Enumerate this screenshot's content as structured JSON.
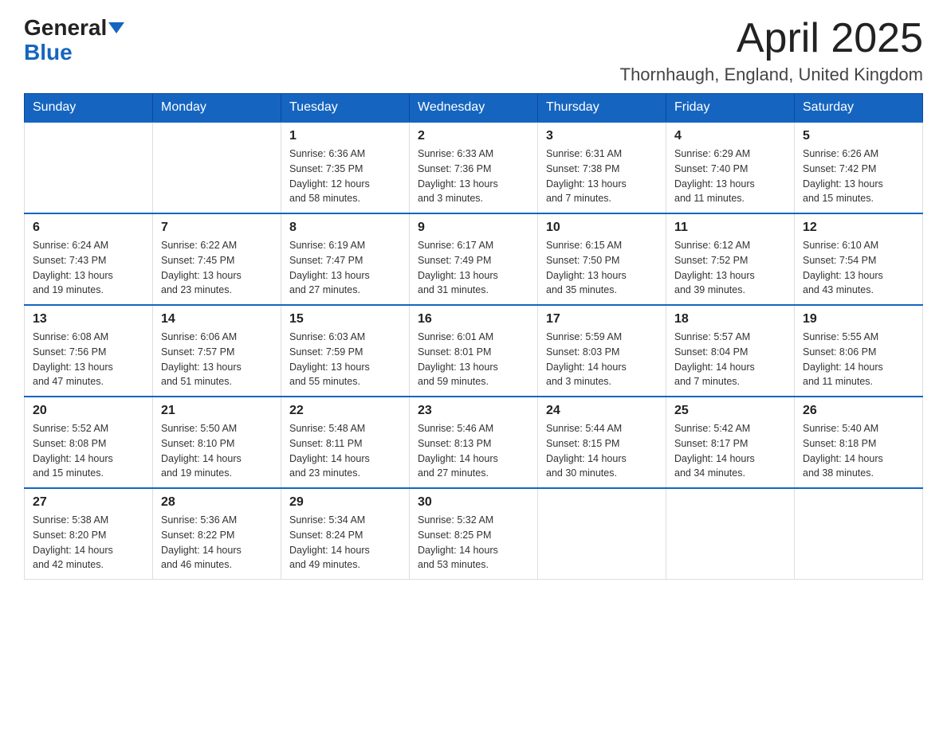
{
  "header": {
    "logo_general": "General",
    "logo_blue": "Blue",
    "title": "April 2025",
    "location": "Thornhaugh, England, United Kingdom"
  },
  "weekdays": [
    "Sunday",
    "Monday",
    "Tuesday",
    "Wednesday",
    "Thursday",
    "Friday",
    "Saturday"
  ],
  "weeks": [
    [
      {
        "day": "",
        "info": ""
      },
      {
        "day": "",
        "info": ""
      },
      {
        "day": "1",
        "info": "Sunrise: 6:36 AM\nSunset: 7:35 PM\nDaylight: 12 hours\nand 58 minutes."
      },
      {
        "day": "2",
        "info": "Sunrise: 6:33 AM\nSunset: 7:36 PM\nDaylight: 13 hours\nand 3 minutes."
      },
      {
        "day": "3",
        "info": "Sunrise: 6:31 AM\nSunset: 7:38 PM\nDaylight: 13 hours\nand 7 minutes."
      },
      {
        "day": "4",
        "info": "Sunrise: 6:29 AM\nSunset: 7:40 PM\nDaylight: 13 hours\nand 11 minutes."
      },
      {
        "day": "5",
        "info": "Sunrise: 6:26 AM\nSunset: 7:42 PM\nDaylight: 13 hours\nand 15 minutes."
      }
    ],
    [
      {
        "day": "6",
        "info": "Sunrise: 6:24 AM\nSunset: 7:43 PM\nDaylight: 13 hours\nand 19 minutes."
      },
      {
        "day": "7",
        "info": "Sunrise: 6:22 AM\nSunset: 7:45 PM\nDaylight: 13 hours\nand 23 minutes."
      },
      {
        "day": "8",
        "info": "Sunrise: 6:19 AM\nSunset: 7:47 PM\nDaylight: 13 hours\nand 27 minutes."
      },
      {
        "day": "9",
        "info": "Sunrise: 6:17 AM\nSunset: 7:49 PM\nDaylight: 13 hours\nand 31 minutes."
      },
      {
        "day": "10",
        "info": "Sunrise: 6:15 AM\nSunset: 7:50 PM\nDaylight: 13 hours\nand 35 minutes."
      },
      {
        "day": "11",
        "info": "Sunrise: 6:12 AM\nSunset: 7:52 PM\nDaylight: 13 hours\nand 39 minutes."
      },
      {
        "day": "12",
        "info": "Sunrise: 6:10 AM\nSunset: 7:54 PM\nDaylight: 13 hours\nand 43 minutes."
      }
    ],
    [
      {
        "day": "13",
        "info": "Sunrise: 6:08 AM\nSunset: 7:56 PM\nDaylight: 13 hours\nand 47 minutes."
      },
      {
        "day": "14",
        "info": "Sunrise: 6:06 AM\nSunset: 7:57 PM\nDaylight: 13 hours\nand 51 minutes."
      },
      {
        "day": "15",
        "info": "Sunrise: 6:03 AM\nSunset: 7:59 PM\nDaylight: 13 hours\nand 55 minutes."
      },
      {
        "day": "16",
        "info": "Sunrise: 6:01 AM\nSunset: 8:01 PM\nDaylight: 13 hours\nand 59 minutes."
      },
      {
        "day": "17",
        "info": "Sunrise: 5:59 AM\nSunset: 8:03 PM\nDaylight: 14 hours\nand 3 minutes."
      },
      {
        "day": "18",
        "info": "Sunrise: 5:57 AM\nSunset: 8:04 PM\nDaylight: 14 hours\nand 7 minutes."
      },
      {
        "day": "19",
        "info": "Sunrise: 5:55 AM\nSunset: 8:06 PM\nDaylight: 14 hours\nand 11 minutes."
      }
    ],
    [
      {
        "day": "20",
        "info": "Sunrise: 5:52 AM\nSunset: 8:08 PM\nDaylight: 14 hours\nand 15 minutes."
      },
      {
        "day": "21",
        "info": "Sunrise: 5:50 AM\nSunset: 8:10 PM\nDaylight: 14 hours\nand 19 minutes."
      },
      {
        "day": "22",
        "info": "Sunrise: 5:48 AM\nSunset: 8:11 PM\nDaylight: 14 hours\nand 23 minutes."
      },
      {
        "day": "23",
        "info": "Sunrise: 5:46 AM\nSunset: 8:13 PM\nDaylight: 14 hours\nand 27 minutes."
      },
      {
        "day": "24",
        "info": "Sunrise: 5:44 AM\nSunset: 8:15 PM\nDaylight: 14 hours\nand 30 minutes."
      },
      {
        "day": "25",
        "info": "Sunrise: 5:42 AM\nSunset: 8:17 PM\nDaylight: 14 hours\nand 34 minutes."
      },
      {
        "day": "26",
        "info": "Sunrise: 5:40 AM\nSunset: 8:18 PM\nDaylight: 14 hours\nand 38 minutes."
      }
    ],
    [
      {
        "day": "27",
        "info": "Sunrise: 5:38 AM\nSunset: 8:20 PM\nDaylight: 14 hours\nand 42 minutes."
      },
      {
        "day": "28",
        "info": "Sunrise: 5:36 AM\nSunset: 8:22 PM\nDaylight: 14 hours\nand 46 minutes."
      },
      {
        "day": "29",
        "info": "Sunrise: 5:34 AM\nSunset: 8:24 PM\nDaylight: 14 hours\nand 49 minutes."
      },
      {
        "day": "30",
        "info": "Sunrise: 5:32 AM\nSunset: 8:25 PM\nDaylight: 14 hours\nand 53 minutes."
      },
      {
        "day": "",
        "info": ""
      },
      {
        "day": "",
        "info": ""
      },
      {
        "day": "",
        "info": ""
      }
    ]
  ]
}
